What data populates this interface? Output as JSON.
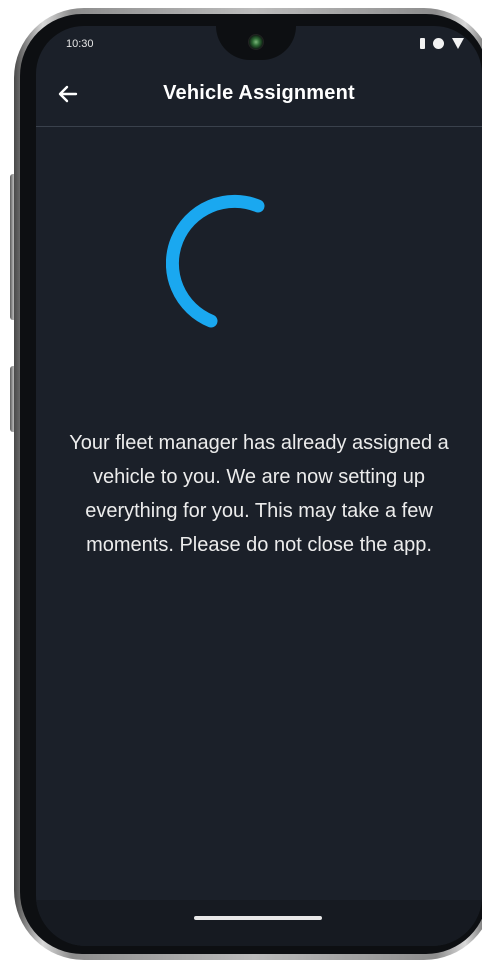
{
  "status_bar": {
    "time": "10:30",
    "icons": [
      "signal-icon",
      "record-dot-icon",
      "wifi-triangle-icon"
    ]
  },
  "app_bar": {
    "title": "Vehicle Assignment",
    "back_icon": "arrow-left-icon"
  },
  "loading": {
    "spinner_icon": "loading-spinner-icon",
    "accent_color": "#1aa8f0"
  },
  "message": {
    "text": "Your fleet manager has already assigned a vehicle to you. We are now setting up everything for you. This may take a few moments. Please do not close the app."
  },
  "colors": {
    "background": "#1b2029",
    "text": "#ececec",
    "title": "#ffffff"
  }
}
